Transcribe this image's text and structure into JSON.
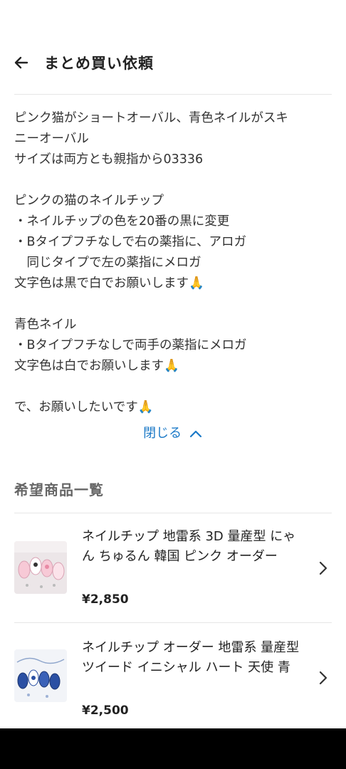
{
  "header": {
    "title": "まとめ買い依頼"
  },
  "message": {
    "lines": [
      "ピンク猫がショートオーバル、青色ネイルがスキ",
      "ニーオーバル",
      "サイズは両方とも親指から03336",
      "",
      "ピンクの猫のネイルチップ",
      "・ネイルチップの色を20番の黒に変更",
      "・Bタイプフチなしで右の薬指に、アロガ",
      "　同じタイプで左の薬指にメロガ",
      "文字色は黒で白でお願いします🙏",
      "",
      "青色ネイル",
      "・Bタイプフチなしで両手の薬指にメロガ",
      "文字色は白でお願いします🙏",
      "",
      "で、お願いしたいです🙏"
    ],
    "collapse_label": "閉じる"
  },
  "products": {
    "section_title": "希望商品一覧",
    "items": [
      {
        "name": "ネイルチップ 地雷系 3D 量産型 にゃん ちゅるん 韓国 ピンク オーダー",
        "price": "¥2,850"
      },
      {
        "name": "ネイルチップ オーダー 地雷系 量産型 ツイード イニシャル ハート 天使 青",
        "price": "¥2,500"
      }
    ]
  },
  "colors": {
    "link": "#1b79c7",
    "divider": "#e6e6e6",
    "text": "#222222"
  }
}
